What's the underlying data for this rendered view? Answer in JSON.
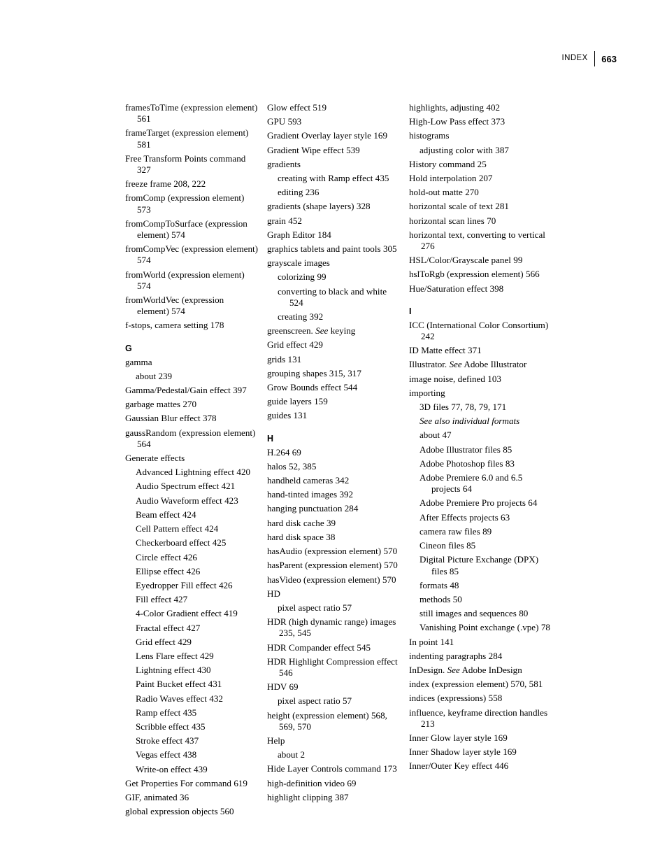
{
  "header": {
    "label": "INDEX",
    "folio": "663"
  },
  "columns": [
    {
      "id": "column-1",
      "entries": [
        {
          "level": 0,
          "text": "framesToTime (expression element) 561"
        },
        {
          "level": 0,
          "text": "frameTarget (expression element) 581"
        },
        {
          "level": 0,
          "text": "Free Transform Points command 327"
        },
        {
          "level": 0,
          "text": "freeze frame 208, 222"
        },
        {
          "level": 0,
          "text": "fromComp (expression element) 573"
        },
        {
          "level": 0,
          "text": "fromCompToSurface (expression element) 574"
        },
        {
          "level": 0,
          "text": "fromCompVec (expression element) 574"
        },
        {
          "level": 0,
          "text": "fromWorld (expression element) 574"
        },
        {
          "level": 0,
          "text": "fromWorldVec (expression element) 574"
        },
        {
          "level": 0,
          "text": "f-stops, camera setting 178"
        },
        {
          "level": 0,
          "heading": "G"
        },
        {
          "level": 0,
          "text": "gamma"
        },
        {
          "level": 1,
          "text": "about 239"
        },
        {
          "level": 0,
          "text": "Gamma/Pedestal/Gain effect 397"
        },
        {
          "level": 0,
          "text": "garbage mattes 270"
        },
        {
          "level": 0,
          "text": "Gaussian Blur effect 378"
        },
        {
          "level": 0,
          "text": "gaussRandom (expression element) 564"
        },
        {
          "level": 0,
          "text": "Generate effects"
        },
        {
          "level": 1,
          "text": "Advanced Lightning effect 420"
        },
        {
          "level": 1,
          "text": "Audio Spectrum effect 421"
        },
        {
          "level": 1,
          "text": "Audio Waveform effect 423"
        },
        {
          "level": 1,
          "text": "Beam effect 424"
        },
        {
          "level": 1,
          "text": "Cell Pattern effect 424"
        },
        {
          "level": 1,
          "text": "Checkerboard effect 425"
        },
        {
          "level": 1,
          "text": "Circle effect 426"
        },
        {
          "level": 1,
          "text": "Ellipse effect 426"
        },
        {
          "level": 1,
          "text": "Eyedropper Fill effect 426"
        },
        {
          "level": 1,
          "text": "Fill effect 427"
        },
        {
          "level": 1,
          "text": "4-Color Gradient effect 419"
        },
        {
          "level": 1,
          "text": "Fractal effect 427"
        },
        {
          "level": 1,
          "text": "Grid effect 429"
        },
        {
          "level": 1,
          "text": "Lens Flare effect 429"
        },
        {
          "level": 1,
          "text": "Lightning effect 430"
        },
        {
          "level": 1,
          "text": "Paint Bucket effect 431"
        },
        {
          "level": 1,
          "text": "Radio Waves effect 432"
        },
        {
          "level": 1,
          "text": "Ramp effect 435"
        },
        {
          "level": 1,
          "text": "Scribble effect 435"
        },
        {
          "level": 1,
          "text": "Stroke effect 437"
        },
        {
          "level": 1,
          "text": "Vegas effect 438"
        },
        {
          "level": 1,
          "text": "Write-on effect 439"
        },
        {
          "level": 0,
          "text": "Get Properties For command 619"
        },
        {
          "level": 0,
          "text": "GIF, animated 36"
        },
        {
          "level": 0,
          "text": "global expression objects 560"
        }
      ]
    },
    {
      "id": "column-2",
      "entries": [
        {
          "level": 0,
          "text": "Glow effect 519"
        },
        {
          "level": 0,
          "text": "GPU 593"
        },
        {
          "level": 0,
          "text": "Gradient Overlay layer style 169"
        },
        {
          "level": 0,
          "text": "Gradient Wipe effect 539"
        },
        {
          "level": 0,
          "text": "gradients"
        },
        {
          "level": 1,
          "text": "creating with Ramp effect 435"
        },
        {
          "level": 1,
          "text": "editing 236"
        },
        {
          "level": 0,
          "text": "gradients (shape layers) 328"
        },
        {
          "level": 0,
          "text": "grain 452"
        },
        {
          "level": 0,
          "text": "Graph Editor 184"
        },
        {
          "level": 0,
          "text": "graphics tablets and paint tools 305"
        },
        {
          "level": 0,
          "text": "grayscale images"
        },
        {
          "level": 1,
          "text": "colorizing 99"
        },
        {
          "level": 1,
          "text": "converting to black and white 524"
        },
        {
          "level": 1,
          "text": "creating 392"
        },
        {
          "level": 0,
          "html": "greenscreen. <em>See</em> keying",
          "text": "greenscreen. See keying"
        },
        {
          "level": 0,
          "text": "Grid effect 429"
        },
        {
          "level": 0,
          "text": "grids 131"
        },
        {
          "level": 0,
          "text": "grouping shapes 315, 317"
        },
        {
          "level": 0,
          "text": "Grow Bounds effect 544"
        },
        {
          "level": 0,
          "text": "guide layers 159"
        },
        {
          "level": 0,
          "text": "guides 131"
        },
        {
          "level": 0,
          "heading": "H"
        },
        {
          "level": 0,
          "text": "H.264 69"
        },
        {
          "level": 0,
          "text": "halos 52, 385"
        },
        {
          "level": 0,
          "text": "handheld cameras 342"
        },
        {
          "level": 0,
          "text": "hand-tinted images 392"
        },
        {
          "level": 0,
          "text": "hanging punctuation 284"
        },
        {
          "level": 0,
          "text": "hard disk cache 39"
        },
        {
          "level": 0,
          "text": "hard disk space 38"
        },
        {
          "level": 0,
          "text": "hasAudio (expression element) 570"
        },
        {
          "level": 0,
          "text": "hasParent (expression element) 570"
        },
        {
          "level": 0,
          "text": "hasVideo (expression element) 570"
        },
        {
          "level": 0,
          "text": "HD"
        },
        {
          "level": 1,
          "text": "pixel aspect ratio 57"
        },
        {
          "level": 0,
          "text": "HDR (high dynamic range) images 235, 545"
        },
        {
          "level": 0,
          "text": "HDR Compander effect 545"
        },
        {
          "level": 0,
          "text": "HDR Highlight Compression effect 546"
        },
        {
          "level": 0,
          "text": "HDV 69"
        },
        {
          "level": 1,
          "text": "pixel aspect ratio 57"
        },
        {
          "level": 0,
          "text": "height (expression element) 568, 569, 570"
        },
        {
          "level": 0,
          "text": "Help"
        },
        {
          "level": 1,
          "text": "about 2"
        },
        {
          "level": 0,
          "text": "Hide Layer Controls command 173"
        },
        {
          "level": 0,
          "text": "high-definition video 69"
        },
        {
          "level": 0,
          "text": "highlight clipping 387"
        }
      ]
    },
    {
      "id": "column-3",
      "entries": [
        {
          "level": 0,
          "text": "highlights, adjusting 402"
        },
        {
          "level": 0,
          "text": "High-Low Pass effect 373"
        },
        {
          "level": 0,
          "text": "histograms"
        },
        {
          "level": 1,
          "text": "adjusting color with 387"
        },
        {
          "level": 0,
          "text": "History command 25"
        },
        {
          "level": 0,
          "text": "Hold interpolation 207"
        },
        {
          "level": 0,
          "text": "hold-out matte 270"
        },
        {
          "level": 0,
          "text": "horizontal scale of text 281"
        },
        {
          "level": 0,
          "text": "horizontal scan lines 70"
        },
        {
          "level": 0,
          "text": "horizontal text, converting to vertical 276"
        },
        {
          "level": 0,
          "text": "HSL/Color/Grayscale panel 99"
        },
        {
          "level": 0,
          "text": "hslToRgb (expression element) 566"
        },
        {
          "level": 0,
          "text": "Hue/Saturation effect 398"
        },
        {
          "level": 0,
          "heading": "I"
        },
        {
          "level": 0,
          "text": "ICC (International Color Consortium) 242"
        },
        {
          "level": 0,
          "text": "ID Matte effect 371"
        },
        {
          "level": 0,
          "html": "Illustrator. <em>See</em> Adobe Illustrator",
          "text": "Illustrator. See Adobe Illustrator"
        },
        {
          "level": 0,
          "text": "image noise, defined 103"
        },
        {
          "level": 0,
          "text": "importing"
        },
        {
          "level": 1,
          "text": "3D files 77, 78, 79, 171"
        },
        {
          "level": 1,
          "html": "<em>See also individual formats</em>",
          "text": "See also individual formats"
        },
        {
          "level": 1,
          "text": "about 47"
        },
        {
          "level": 1,
          "text": "Adobe Illustrator files 85"
        },
        {
          "level": 1,
          "text": "Adobe Photoshop files 83"
        },
        {
          "level": 1,
          "text": "Adobe Premiere 6.0 and 6.5 projects 64"
        },
        {
          "level": 1,
          "text": "Adobe Premiere Pro projects 64"
        },
        {
          "level": 1,
          "text": "After Effects projects 63"
        },
        {
          "level": 1,
          "text": "camera raw files 89"
        },
        {
          "level": 1,
          "text": "Cineon files 85"
        },
        {
          "level": 1,
          "text": "Digital Picture Exchange (DPX) files 85"
        },
        {
          "level": 1,
          "text": "formats 48"
        },
        {
          "level": 1,
          "text": "methods 50"
        },
        {
          "level": 1,
          "text": "still images and sequences 80"
        },
        {
          "level": 1,
          "text": "Vanishing Point exchange (.vpe) 78"
        },
        {
          "level": 0,
          "text": "In point 141"
        },
        {
          "level": 0,
          "text": "indenting paragraphs 284"
        },
        {
          "level": 0,
          "html": "InDesign. <em>See</em> Adobe InDesign",
          "text": "InDesign. See Adobe InDesign"
        },
        {
          "level": 0,
          "text": "index (expression element) 570, 581"
        },
        {
          "level": 0,
          "text": "indices (expressions) 558"
        },
        {
          "level": 0,
          "text": "influence, keyframe direction handles 213"
        },
        {
          "level": 0,
          "text": "Inner Glow layer style 169"
        },
        {
          "level": 0,
          "text": "Inner Shadow layer style 169"
        },
        {
          "level": 0,
          "text": "Inner/Outer Key effect 446"
        }
      ]
    }
  ]
}
